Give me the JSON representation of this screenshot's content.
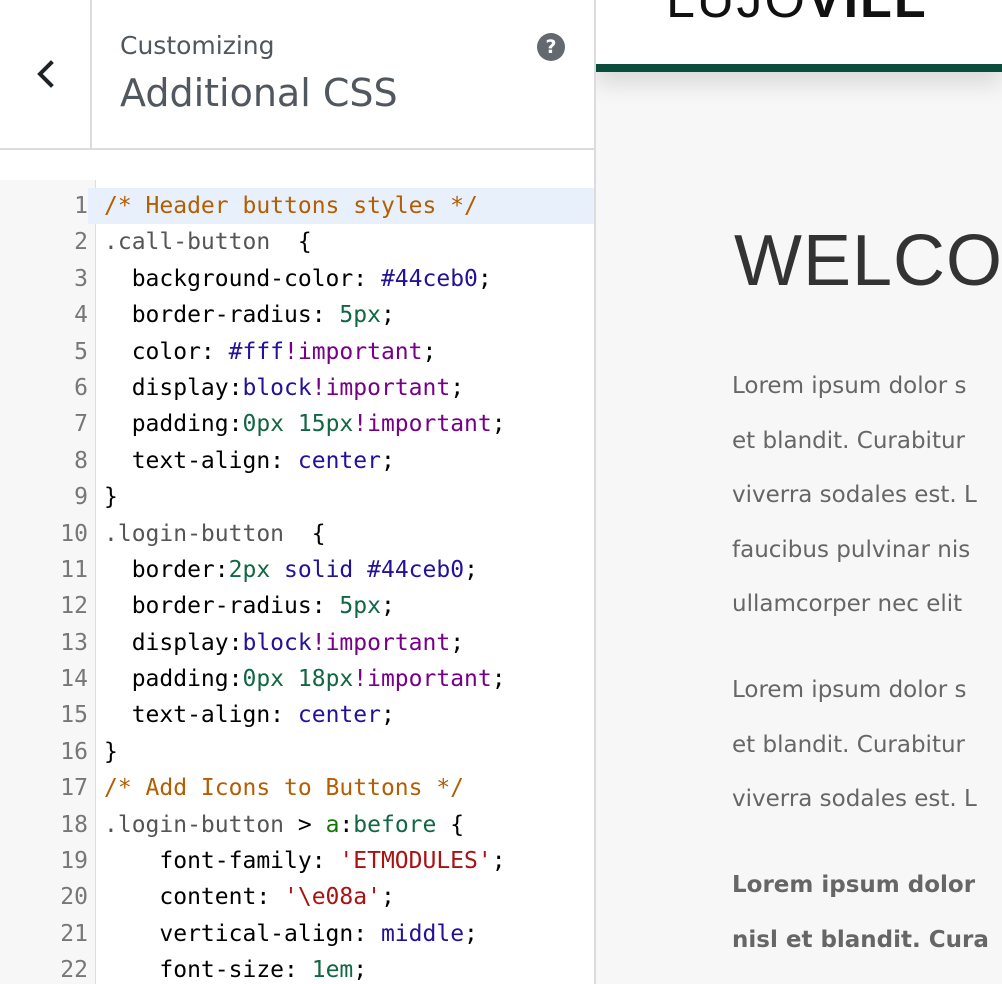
{
  "panel": {
    "subtitle": "Customizing",
    "title": "Additional CSS",
    "help": "?"
  },
  "code": [
    {
      "n": "1",
      "tokens": [
        {
          "t": "com",
          "s": "/* Header buttons styles */"
        }
      ]
    },
    {
      "n": "2",
      "tokens": [
        {
          "t": "qual",
          "s": ".call-button"
        },
        {
          "t": "prop",
          "s": "  {"
        }
      ]
    },
    {
      "n": "3",
      "tokens": [
        {
          "t": "prop",
          "s": "  background-color: "
        },
        {
          "t": "atom",
          "s": "#44ceb0"
        },
        {
          "t": "prop",
          "s": ";"
        }
      ]
    },
    {
      "n": "4",
      "tokens": [
        {
          "t": "prop",
          "s": "  border-radius: "
        },
        {
          "t": "num",
          "s": "5px"
        },
        {
          "t": "prop",
          "s": ";"
        }
      ]
    },
    {
      "n": "5",
      "tokens": [
        {
          "t": "prop",
          "s": "  color: "
        },
        {
          "t": "atom",
          "s": "#fff"
        },
        {
          "t": "kw",
          "s": "!important"
        },
        {
          "t": "prop",
          "s": ";"
        }
      ]
    },
    {
      "n": "6",
      "tokens": [
        {
          "t": "prop",
          "s": "  display:"
        },
        {
          "t": "atom",
          "s": "block"
        },
        {
          "t": "kw",
          "s": "!important"
        },
        {
          "t": "prop",
          "s": ";"
        }
      ]
    },
    {
      "n": "7",
      "tokens": [
        {
          "t": "prop",
          "s": "  padding:"
        },
        {
          "t": "num",
          "s": "0px 15px"
        },
        {
          "t": "kw",
          "s": "!important"
        },
        {
          "t": "prop",
          "s": ";"
        }
      ]
    },
    {
      "n": "8",
      "tokens": [
        {
          "t": "prop",
          "s": "  text-align: "
        },
        {
          "t": "atom",
          "s": "center"
        },
        {
          "t": "prop",
          "s": ";"
        }
      ]
    },
    {
      "n": "9",
      "tokens": [
        {
          "t": "prop",
          "s": "}"
        }
      ]
    },
    {
      "n": "10",
      "tokens": [
        {
          "t": "qual",
          "s": ".login-button"
        },
        {
          "t": "prop",
          "s": "  {"
        }
      ]
    },
    {
      "n": "11",
      "tokens": [
        {
          "t": "prop",
          "s": "  border:"
        },
        {
          "t": "num",
          "s": "2px"
        },
        {
          "t": "prop",
          "s": " "
        },
        {
          "t": "atom",
          "s": "solid"
        },
        {
          "t": "prop",
          "s": " "
        },
        {
          "t": "atom",
          "s": "#44ceb0"
        },
        {
          "t": "prop",
          "s": ";"
        }
      ]
    },
    {
      "n": "12",
      "tokens": [
        {
          "t": "prop",
          "s": "  border-radius: "
        },
        {
          "t": "num",
          "s": "5px"
        },
        {
          "t": "prop",
          "s": ";"
        }
      ]
    },
    {
      "n": "13",
      "tokens": [
        {
          "t": "prop",
          "s": "  display:"
        },
        {
          "t": "atom",
          "s": "block"
        },
        {
          "t": "kw",
          "s": "!important"
        },
        {
          "t": "prop",
          "s": ";"
        }
      ]
    },
    {
      "n": "14",
      "tokens": [
        {
          "t": "prop",
          "s": "  padding:"
        },
        {
          "t": "num",
          "s": "0px 18px"
        },
        {
          "t": "kw",
          "s": "!important"
        },
        {
          "t": "prop",
          "s": ";"
        }
      ]
    },
    {
      "n": "15",
      "tokens": [
        {
          "t": "prop",
          "s": "  text-align: "
        },
        {
          "t": "atom",
          "s": "center"
        },
        {
          "t": "prop",
          "s": ";"
        }
      ]
    },
    {
      "n": "16",
      "tokens": [
        {
          "t": "prop",
          "s": "}"
        }
      ]
    },
    {
      "n": "17",
      "tokens": [
        {
          "t": "com",
          "s": "/* Add Icons to Buttons */"
        }
      ]
    },
    {
      "n": "18",
      "tokens": [
        {
          "t": "qual",
          "s": ".login-button"
        },
        {
          "t": "prop",
          "s": " > "
        },
        {
          "t": "tag",
          "s": "a"
        },
        {
          "t": "prop",
          "s": ":"
        },
        {
          "t": "num",
          "s": "before"
        },
        {
          "t": "prop",
          "s": " {"
        }
      ]
    },
    {
      "n": "19",
      "tokens": [
        {
          "t": "prop",
          "s": "    font-family: "
        },
        {
          "t": "str",
          "s": "'ETMODULES'"
        },
        {
          "t": "prop",
          "s": ";"
        }
      ]
    },
    {
      "n": "20",
      "tokens": [
        {
          "t": "prop",
          "s": "    content: "
        },
        {
          "t": "str",
          "s": "'\\e08a'"
        },
        {
          "t": "prop",
          "s": ";"
        }
      ]
    },
    {
      "n": "21",
      "tokens": [
        {
          "t": "prop",
          "s": "    vertical-align: "
        },
        {
          "t": "atom",
          "s": "middle"
        },
        {
          "t": "prop",
          "s": ";"
        }
      ]
    },
    {
      "n": "22",
      "tokens": [
        {
          "t": "prop",
          "s": "    font-size: "
        },
        {
          "t": "num",
          "s": "1em"
        },
        {
          "t": "prop",
          "s": ";"
        }
      ]
    }
  ],
  "preview": {
    "logo_thin": "LUJO",
    "logo_bold": "VILL",
    "heading": "WELCO",
    "para1": [
      "Lorem ipsum dolor s",
      "et blandit. Curabitur",
      "viverra sodales est. L",
      "faucibus pulvinar nis",
      "ullamcorper nec elit"
    ],
    "para2": [
      "Lorem ipsum dolor s",
      "et blandit. Curabitur",
      "viverra sodales est. L"
    ],
    "para3": [
      "Lorem ipsum dolor",
      "nisl et blandit. Cura"
    ]
  },
  "colors": {
    "header_rule": "#0b4d3c",
    "active_line": "#e8f0fb",
    "help_icon_bg": "#646970"
  }
}
